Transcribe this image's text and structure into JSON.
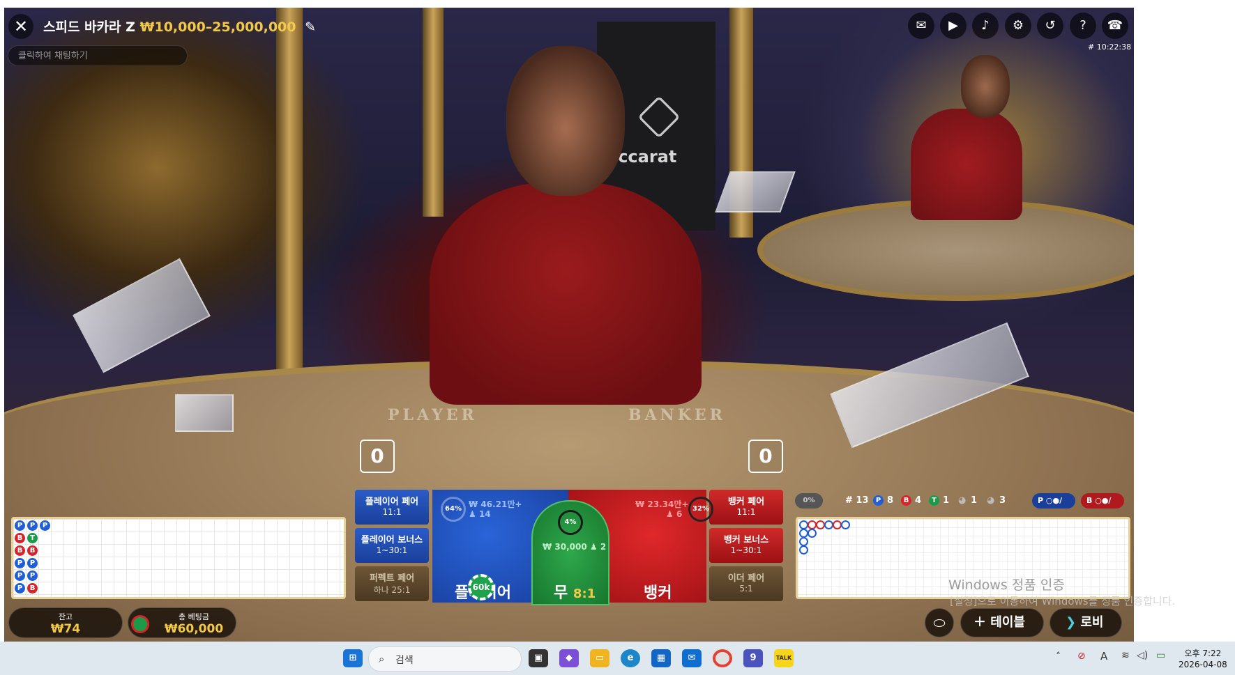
{
  "header": {
    "title": "스피드 바카라 Z",
    "limits": "₩10,000–25,000,000",
    "chat_placeholder": "클릭하여 채팅하기",
    "game_id": "# 10:22:38"
  },
  "toolbar_icons": [
    "chat-icon",
    "video-icon",
    "volume-icon",
    "gear-icon",
    "history-icon",
    "help-icon",
    "support-icon"
  ],
  "scene": {
    "player_word": "PLAYER",
    "banker_word": "BANKER",
    "banner_text": "accarat",
    "player_score": "0",
    "banker_score": "0"
  },
  "bead_road": [
    [
      "P",
      "P",
      "P"
    ],
    [
      "B",
      "T"
    ],
    [
      "B",
      "B"
    ],
    [
      "P",
      "P"
    ],
    [
      "P",
      "P"
    ],
    [
      "P",
      "B"
    ]
  ],
  "bets": {
    "player_pair": {
      "label": "플레이어 페어",
      "odds": "11:1"
    },
    "player_bonus": {
      "label": "플레이어 보너스",
      "odds": "1~30:1"
    },
    "perfect_pair": {
      "label": "퍼펙트 페어",
      "odds": "하나 25:1"
    },
    "banker_pair": {
      "label": "뱅커 페어",
      "odds": "11:1"
    },
    "banker_bonus": {
      "label": "뱅커 보너스",
      "odds": "1~30:1"
    },
    "either_pair": {
      "label": "이더 페어",
      "odds": "5:1"
    },
    "player": {
      "label": "플레이어",
      "pct": "64%",
      "amount": "₩ 46.21만+",
      "players": "14",
      "chip": "60k"
    },
    "tie": {
      "label": "무",
      "odds": "8:1",
      "pct": "4%",
      "amount": "₩ 30,000",
      "players": "2"
    },
    "banker": {
      "label": "뱅커",
      "pct": "32%",
      "amount": "₩ 23.34만+",
      "players": "6"
    }
  },
  "stats": {
    "toggle": "0%",
    "rounds": "# 13",
    "player": "8",
    "banker": "4",
    "tie": "1",
    "player_pair": "1",
    "banker_pair": "3",
    "p_label": "P",
    "b_label": "B",
    "t_label": "T"
  },
  "watermark": {
    "line1": "Windows 정품 인증",
    "line2": "[설정]으로 이동하여 Windows를 정품 인증합니다."
  },
  "balance": {
    "label": "잔고",
    "value": "₩74"
  },
  "total_bet": {
    "label": "총 베팅금",
    "value": "₩60,000"
  },
  "buttons": {
    "table": "테이블",
    "lobby": "로비"
  },
  "taskbar": {
    "search": "검색",
    "time": "오후 7:22",
    "date": "2026-04-08",
    "teams_badge": "9",
    "kakao": "TALK"
  },
  "colors": {
    "player": "#1f5ed8",
    "banker": "#d8232a",
    "tie": "#1b9a48",
    "gold": "#f3c94a"
  }
}
